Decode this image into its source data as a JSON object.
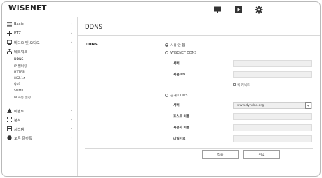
{
  "app": {
    "logo": "WISENET"
  },
  "header": {
    "icons": [
      "monitor-icon",
      "playback-icon",
      "gear-icon"
    ]
  },
  "sidebar": {
    "items": [
      {
        "label": "Basic",
        "icon": "menu-icon",
        "expanded": false
      },
      {
        "label": "PTZ",
        "icon": "ptz-icon",
        "expanded": false
      },
      {
        "label": "비디오 및 오디오",
        "icon": "video-audio-icon",
        "expanded": false
      },
      {
        "label": "네트워크",
        "icon": "network-icon",
        "expanded": true
      },
      {
        "label": "이벤트",
        "icon": "event-icon",
        "expanded": false
      },
      {
        "label": "분석",
        "icon": "analysis-icon",
        "expanded": false
      },
      {
        "label": "시스템",
        "icon": "system-icon",
        "expanded": false
      },
      {
        "label": "오픈 플랫폼",
        "icon": "open-platform-icon",
        "expanded": false
      }
    ],
    "network_subitems": [
      "DDNS",
      "IP 필터링",
      "HTTPS",
      "802.1x",
      "QoS",
      "SNMP",
      "IP 자동 설정"
    ]
  },
  "main": {
    "title": "DDNS",
    "section_label": "DDNS",
    "options": {
      "disabled": "사용 안 함",
      "wisenet_ddns": "WISENET DDNS",
      "public_ddns": "공개 DDNS"
    },
    "selected_option": "disabled",
    "wisenet_fields": {
      "server_label": "서버",
      "product_id_label": "제품 ID",
      "quick_connect_label": "퀵 커넥트"
    },
    "public_fields": {
      "server_label": "서버",
      "server_value": "www.dyndns.org",
      "hostname_label": "호스트 이름",
      "username_label": "사용자 이름",
      "password_label": "비밀번호"
    },
    "buttons": {
      "apply": "적용",
      "cancel": "취소"
    }
  }
}
